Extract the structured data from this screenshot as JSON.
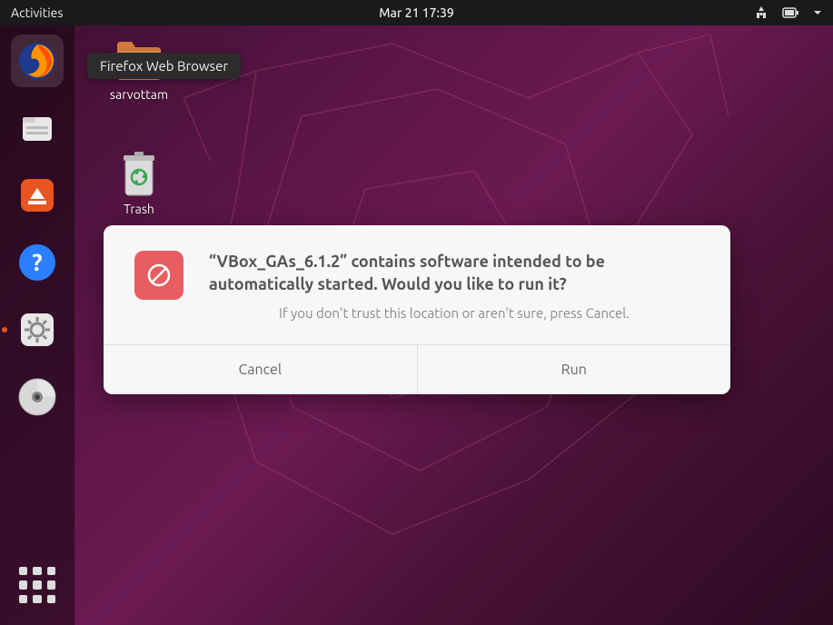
{
  "topbar": {
    "activities": "Activities",
    "datetime": "Mar 21  17:39"
  },
  "tooltip": "Firefox Web Browser",
  "desktop": {
    "home_label": "sarvottam",
    "trash_label": "Trash"
  },
  "dialog": {
    "title": "“VBox_GAs_6.1.2” contains software intended to be automatically started. Would you like to run it?",
    "subtitle": "If you don't trust this location or aren't sure, press Cancel.",
    "cancel": "Cancel",
    "run": "Run"
  }
}
